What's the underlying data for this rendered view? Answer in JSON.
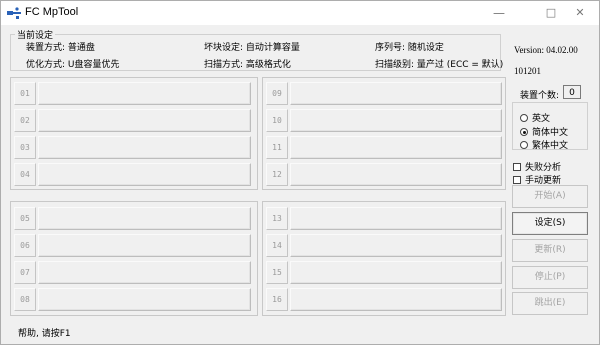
{
  "window": {
    "title": "FC MpTool",
    "minimize": "—",
    "maximize": "□",
    "close": "✕",
    "icon": "usb-icon"
  },
  "settings": {
    "group_label": "当前设定",
    "device_mode": "装置方式: 普通盘",
    "block_setting": "坏块设定: 自动计算容量",
    "serial": "序列号: 随机设定",
    "optimize": "优化方式: U盘容量优先",
    "scan_mode": "扫描方式: 高级格式化",
    "scan_level": "扫描级别: 量产过 (ECC = 默认)"
  },
  "slots_top_left": [
    "01",
    "02",
    "03",
    "04"
  ],
  "slots_top_right": [
    "09",
    "10",
    "11",
    "12"
  ],
  "slots_bottom_left": [
    "05",
    "06",
    "07",
    "08"
  ],
  "slots_bottom_right": [
    "13",
    "14",
    "15",
    "16"
  ],
  "sidebar": {
    "version": "Version: 04.02.00",
    "build": "101201",
    "device_count_label": "装置个数:",
    "device_count": "0",
    "languages": [
      {
        "label": "英文",
        "selected": false
      },
      {
        "label": "简体中文",
        "selected": true
      },
      {
        "label": "繁体中文",
        "selected": false
      }
    ],
    "failure_analysis": "失败分析",
    "manual_update": "手动更新",
    "buttons": {
      "start": "开始(A)",
      "settings": "设定(S)",
      "update": "更新(R)",
      "stop": "停止(P)",
      "exit": "跳出(E)"
    }
  },
  "status": "帮助, 请按F1"
}
